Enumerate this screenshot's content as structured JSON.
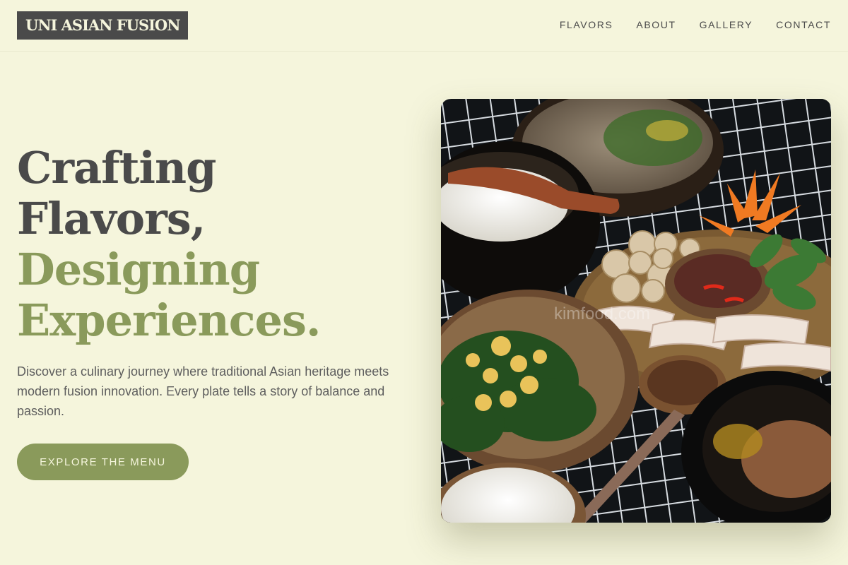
{
  "brand": {
    "logo_text": "UNI ASIAN FUSION"
  },
  "nav": {
    "items": [
      {
        "label": "FLAVORS"
      },
      {
        "label": "ABOUT"
      },
      {
        "label": "GALLERY"
      },
      {
        "label": "CONTACT"
      }
    ]
  },
  "hero": {
    "title_line1": "Crafting",
    "title_line2": "Flavors,",
    "title_line3": "Designing",
    "title_line4": "Experiences.",
    "description": "Discover a culinary journey where traditional Asian heritage meets modern fusion innovation. Every plate tells a story of balance and passion.",
    "cta_label": "EXPLORE THE MENU"
  },
  "photo": {
    "watermark": "kimfood.com"
  },
  "colors": {
    "background": "#f5f5dc",
    "text_dark": "#4a4a4a",
    "accent_olive": "#8a9a5b"
  }
}
